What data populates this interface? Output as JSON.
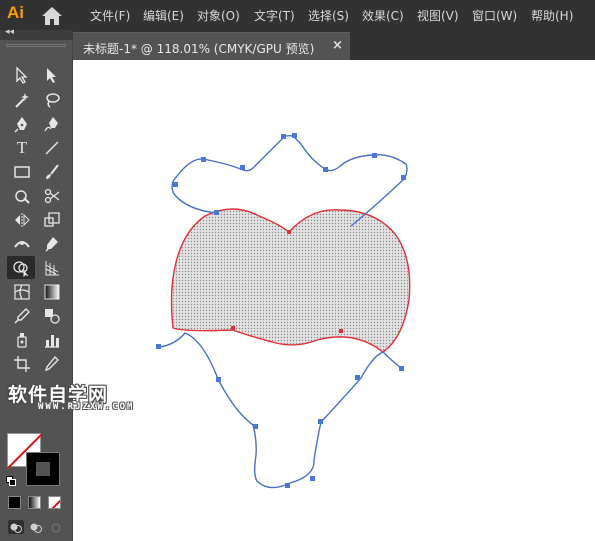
{
  "app": {
    "logo": "Ai"
  },
  "menu": [
    {
      "label": "文件(F)"
    },
    {
      "label": "编辑(E)"
    },
    {
      "label": "对象(O)"
    },
    {
      "label": "文字(T)"
    },
    {
      "label": "选择(S)"
    },
    {
      "label": "效果(C)"
    },
    {
      "label": "视图(V)"
    },
    {
      "label": "窗口(W)"
    },
    {
      "label": "帮助(H)"
    }
  ],
  "document_tab": {
    "title": "未标题-1* @ 118.01% (CMYK/GPU 预览)",
    "close_glyph": "×"
  },
  "toolbar": {
    "collapse_glyph": "◂◂",
    "type_tool_glyph": "T",
    "tools": [
      "selection-tool",
      "direct-selection-tool",
      "magic-wand-tool",
      "lasso-tool",
      "pen-tool",
      "curvature-tool",
      "type-tool",
      "line-segment-tool",
      "rectangle-tool",
      "paintbrush-tool",
      "shaper-tool",
      "scissors-tool",
      "reflect-tool",
      "scale-tool",
      "width-tool",
      "puppet-warp-tool",
      "shape-builder-tool",
      "perspective-grid-tool",
      "mesh-tool",
      "gradient-tool",
      "eyedropper-tool",
      "blend-tool",
      "symbol-sprayer-tool",
      "column-graph-tool",
      "artboard-tool",
      "slice-tool"
    ],
    "selected_tool": "shape-builder-tool",
    "fill_color": "#ffffff",
    "stroke_color": "#000000"
  },
  "colors": {
    "path_stroke": "#4a6fc7",
    "anchor": "#4a78d8",
    "heart_stroke": "#e0303a",
    "heart_fill": "#cfcfcf",
    "canvas": "#ffffff",
    "chrome": "#535353",
    "menubar": "#323232",
    "logo": "#ff9a00"
  },
  "watermark": {
    "text": "软件自学网",
    "url": "WWW.RJZXW.COM"
  }
}
